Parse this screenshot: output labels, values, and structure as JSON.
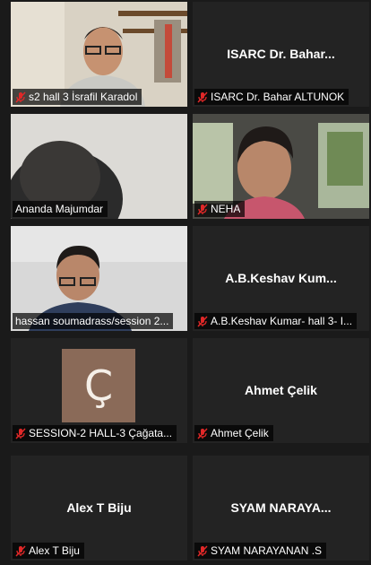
{
  "participants": [
    {
      "name": "s2 hall 3 İsrafil Karadol",
      "display": "",
      "muted": true,
      "video": "man-glasses-shelf",
      "initial": ""
    },
    {
      "name": "ISARC Dr. Bahar ALTUNOK",
      "display": "ISARC Dr. Bahar...",
      "muted": true,
      "video": "",
      "initial": ""
    },
    {
      "name": "Ananda Majumdar",
      "display": "",
      "muted": false,
      "video": "dark-head",
      "initial": ""
    },
    {
      "name": "NEHA",
      "display": "",
      "muted": true,
      "video": "woman-car",
      "initial": ""
    },
    {
      "name": "hassan soumadrass/session 2...",
      "display": "",
      "muted": false,
      "video": "man-glasses-reading",
      "initial": "",
      "active": true
    },
    {
      "name": "A.B.Keshav Kumar- hall 3- I...",
      "display": "A.B.Keshav Kum...",
      "muted": true,
      "video": "",
      "initial": ""
    },
    {
      "name": "SESSION-2 HALL-3 Çağata...",
      "display": "",
      "muted": true,
      "video": "",
      "initial": "Ç"
    },
    {
      "name": "Ahmet Çelik",
      "display": "Ahmet Çelik",
      "muted": true,
      "video": "",
      "initial": ""
    },
    {
      "name": "Alex T Biju",
      "display": "Alex T Biju",
      "muted": true,
      "video": "",
      "initial": ""
    },
    {
      "name": "SYAM NARAYANAN .S",
      "display": "SYAM NARAYA...",
      "muted": true,
      "video": "",
      "initial": ""
    }
  ],
  "colors": {
    "active_border": "#b5e61d",
    "mute_icon": "#e02828",
    "tile_bg": "#232323"
  },
  "icons": {
    "muted": "mic-muted-icon"
  }
}
